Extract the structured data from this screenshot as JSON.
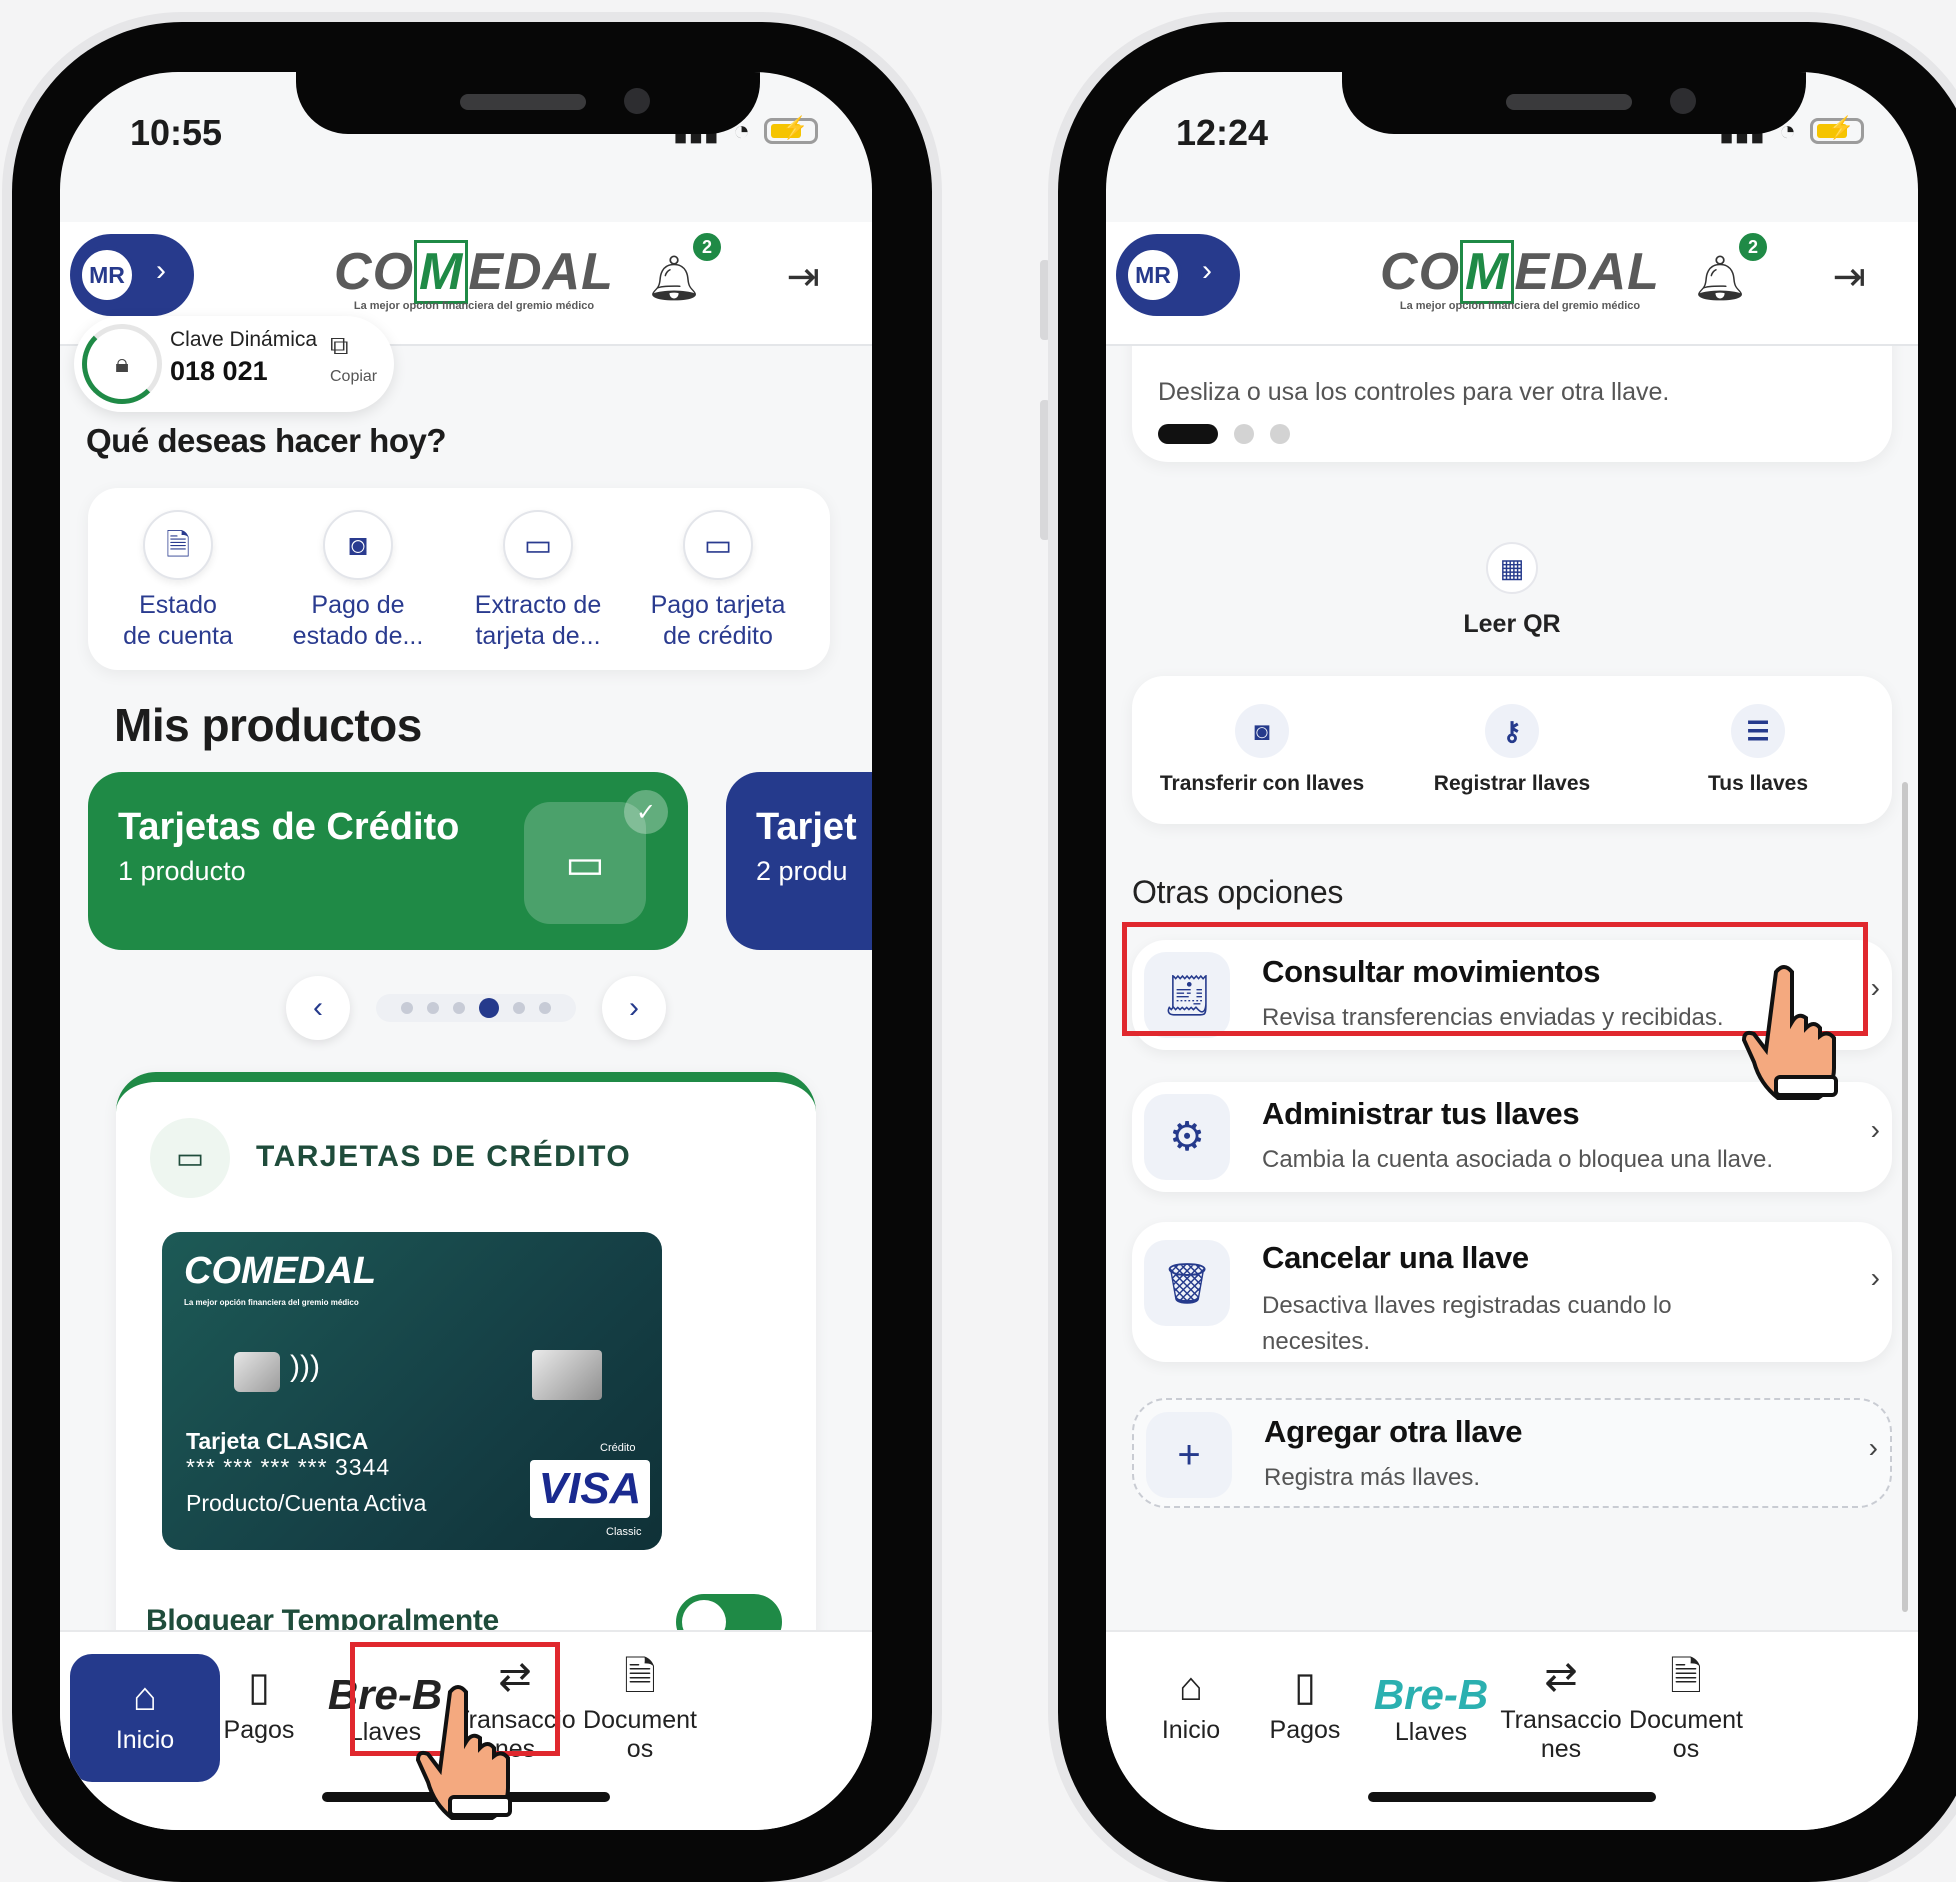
{
  "left": {
    "status": {
      "time": "10:55"
    },
    "header": {
      "avatar_initials": "MR",
      "logo_text_before": "CO",
      "logo_text_m": "M",
      "logo_text_after": "EDAL",
      "logo_tagline": "La mejor opción financiera del gremio médico",
      "notification_count": "2"
    },
    "dynamic_key": {
      "label": "Clave Dinámica",
      "code": "018 021",
      "copy_label": "Copiar"
    },
    "quick_title": "Qué deseas hacer hoy?",
    "quick_actions": [
      {
        "line1": "Estado",
        "line2": "de cuenta",
        "icon": "document-icon"
      },
      {
        "line1": "Pago de",
        "line2": "estado de...",
        "icon": "cash-icon"
      },
      {
        "line1": "Extracto de",
        "line2": "tarjeta de...",
        "icon": "card-icon"
      },
      {
        "line1": "Pago tarjeta",
        "line2": "de crédito",
        "icon": "card-icon"
      }
    ],
    "products_title": "Mis productos",
    "product_cards": [
      {
        "title": "Tarjetas de Crédito",
        "subtitle": "1 producto",
        "color": "#1f8a46"
      },
      {
        "title": "Tarjet",
        "subtitle": "2 produ",
        "color": "#253a8c"
      }
    ],
    "pager": {
      "prev": "‹",
      "next": "›"
    },
    "credit_panel": {
      "header": "TARJETAS DE CRÉDITO",
      "card": {
        "brand_before": "CO",
        "brand_m": "M",
        "brand_after": "EDAL",
        "brand_tagline": "La mejor opción financiera del gremio médico",
        "name": "Tarjeta CLASICA",
        "number": "*** *** *** *** 3344",
        "status": "Producto/Cuenta Activa",
        "type": "Crédito",
        "network": "VISA",
        "tier": "Classic"
      },
      "block_label": "Bloquear Temporalmente",
      "block_enabled": true
    },
    "tabs": [
      {
        "label": "Inicio",
        "icon": "home-icon"
      },
      {
        "label": "Pagos",
        "icon": "wallet-icon"
      },
      {
        "brand": "Bre-B",
        "label": "Llaves"
      },
      {
        "label": "Transaccio\nnes",
        "icon": "transfer-icon"
      },
      {
        "label": "Document\nos",
        "icon": "document-icon"
      }
    ]
  },
  "right": {
    "status": {
      "time": "12:24"
    },
    "header": {
      "avatar_initials": "MR",
      "logo_text_before": "CO",
      "logo_text_m": "M",
      "logo_text_after": "EDAL",
      "logo_tagline": "La mejor opción financiera del gremio médico",
      "notification_count": "2"
    },
    "key_hint": "Desliza o usa los controles para ver otra llave.",
    "qr_label": "Leer QR",
    "actions": [
      {
        "label": "Transferir con llaves",
        "icon": "cash-icon"
      },
      {
        "label": "Registrar llaves",
        "icon": "key-icon"
      },
      {
        "label": "Tus llaves",
        "icon": "list-icon"
      }
    ],
    "other_title": "Otras opciones",
    "options": [
      {
        "title": "Consultar movimientos",
        "desc": "Revisa transferencias enviadas y recibidas.",
        "icon": "receipt-icon"
      },
      {
        "title": "Administrar tus llaves",
        "desc": "Cambia la cuenta asociada o bloquea una llave.",
        "icon": "gear-icon"
      },
      {
        "title": "Cancelar una llave",
        "desc": "Desactiva llaves registradas cuando lo necesites.",
        "icon": "trash-icon"
      },
      {
        "title": "Agregar otra llave",
        "desc": "Registra más llaves.",
        "icon": "plus-icon"
      }
    ],
    "tabs": [
      {
        "label": "Inicio",
        "icon": "home-icon"
      },
      {
        "label": "Pagos",
        "icon": "wallet-icon"
      },
      {
        "brand": "Bre-B",
        "label": "Llaves"
      },
      {
        "label": "Transaccio\nnes",
        "icon": "transfer-icon"
      },
      {
        "label": "Document\nos",
        "icon": "document-icon"
      }
    ]
  },
  "colors": {
    "brand_green": "#1f8a46",
    "brand_blue": "#253a8c",
    "highlight_red": "#e0282e",
    "hand_skin": "#f4a97f"
  }
}
